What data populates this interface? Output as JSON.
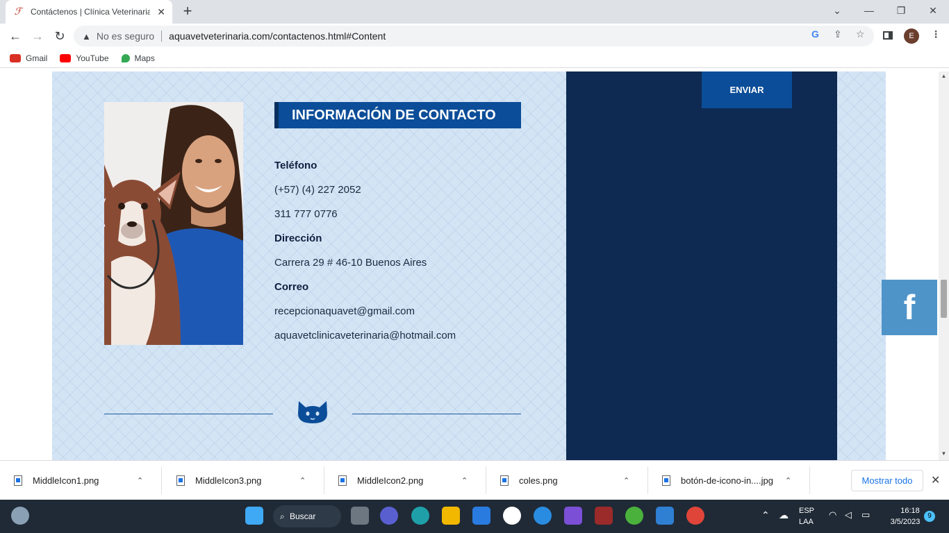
{
  "browser": {
    "tab_title": "Contáctenos | Clínica Veterinaria",
    "security_label": "No es seguro",
    "url": "aquavetveterinaria.com/contactenos.html#Content",
    "profile_initial": "E",
    "bookmarks": [
      {
        "label": "Gmail",
        "color": "#d93025"
      },
      {
        "label": "YouTube",
        "color": "#ff0000"
      },
      {
        "label": "Maps",
        "color": "#34a853"
      }
    ]
  },
  "page": {
    "contact_heading": "INFORMACIÓN DE CONTACTO",
    "phone_label": "Teléfono",
    "phone_1": "(+57) (4) 227 2052",
    "phone_2": "311 777 0776",
    "address_label": "Dirección",
    "address": "Carrera 29 # 46-10 Buenos Aires",
    "email_label": "Correo",
    "email_1": "recepcionaquavet@gmail.com",
    "email_2": "aquavetclinicaveterinaria@hotmail.com",
    "send_button": "ENVIAR",
    "facebook_glyph": "f",
    "colors": {
      "heading_bg": "#0b4d98",
      "form_panel": "#0e2a52",
      "content_bg": "#d3e4f5",
      "facebook": "#4f94c9"
    }
  },
  "downloads": {
    "items": [
      "MiddleIcon1.png",
      "MiddleIcon3.png",
      "MiddleIcon2.png",
      "coles.png",
      "botón-de-icono-in....jpg"
    ],
    "show_all": "Mostrar todo"
  },
  "taskbar": {
    "search_label": "Buscar",
    "lang_top": "ESP",
    "lang_bottom": "LAA",
    "time": "16:18",
    "date": "3/5/2023",
    "notification_count": "9"
  }
}
